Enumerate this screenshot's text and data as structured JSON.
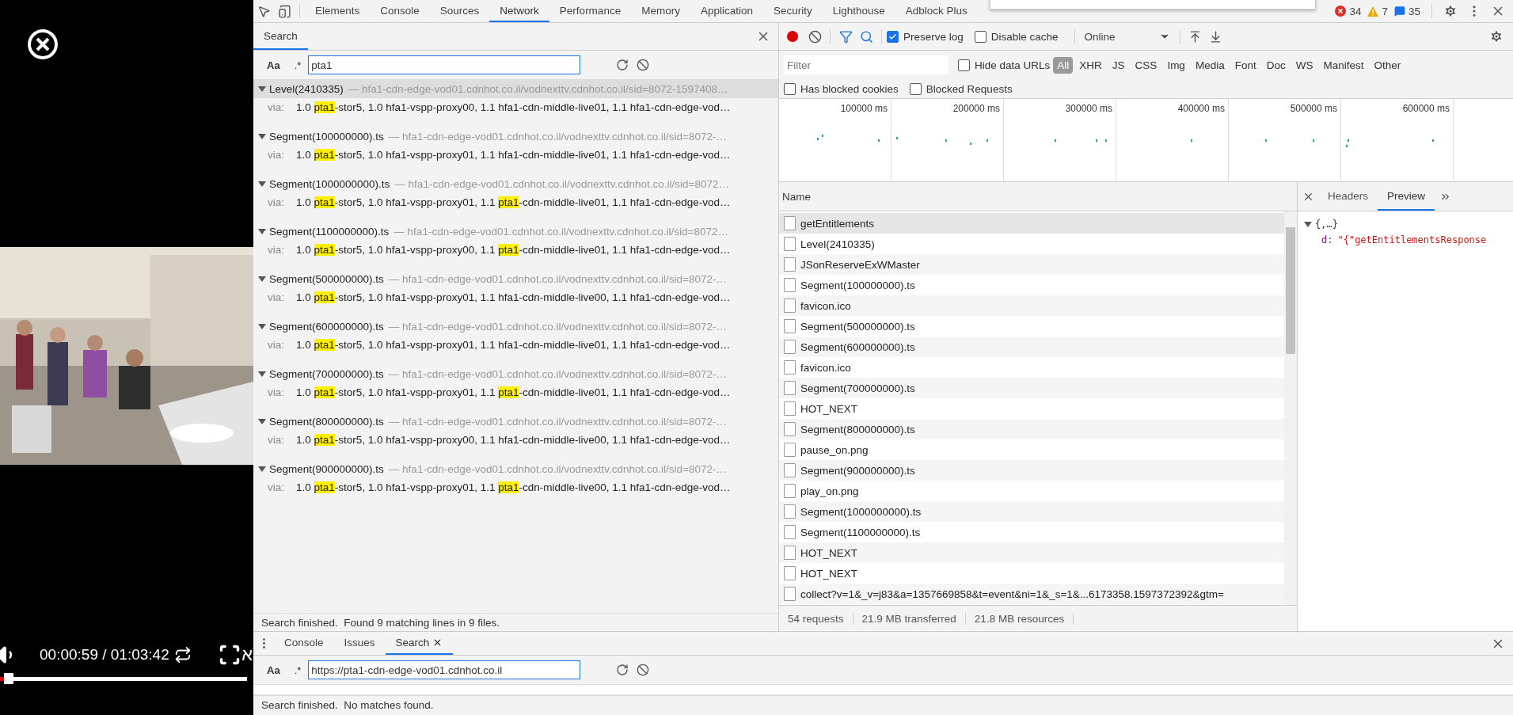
{
  "video": {
    "time": "00:00:59 / 01:03:42",
    "edge_letter": "א",
    "level": 0.03
  },
  "devtools": {
    "tabs": [
      {
        "label": "Elements",
        "selected": false
      },
      {
        "label": "Console",
        "selected": false
      },
      {
        "label": "Sources",
        "selected": false
      },
      {
        "label": "Network",
        "selected": true
      },
      {
        "label": "Performance",
        "selected": false
      },
      {
        "label": "Memory",
        "selected": false
      },
      {
        "label": "Application",
        "selected": false
      },
      {
        "label": "Security",
        "selected": false
      },
      {
        "label": "Lighthouse",
        "selected": false
      },
      {
        "label": "Adblock Plus",
        "selected": false
      }
    ],
    "errors": "34",
    "warnings": "7",
    "messages": "35"
  },
  "search_panel": {
    "title": "Search",
    "case_label": "Aa",
    "regex_label": ".*",
    "query": "pta1",
    "results": [
      {
        "name": "Level(2410335)",
        "url": "— hfa1-cdn-edge-vod01.cdnhot.co.il/vodnexttv.cdnhot.co.il/sid=8072-1597408…",
        "hovered": true,
        "via_label": "via:",
        "segments": [
          {
            "text": "1.0 ",
            "match": false
          },
          {
            "text": "pta1",
            "match": true
          },
          {
            "text": "-stor5, 1.0 hfa1-vspp-proxy00, 1.1 hfa1-cdn-middle-live01, 1.1 hfa1-cdn-edge-vod…",
            "match": false
          }
        ]
      },
      {
        "name": "Segment(100000000).ts",
        "url": "— hfa1-cdn-edge-vod01.cdnhot.co.il/vodnexttv.cdnhot.co.il/sid=8072-…",
        "hovered": false,
        "via_label": "via:",
        "segments": [
          {
            "text": "1.0 ",
            "match": false
          },
          {
            "text": "pta1",
            "match": true
          },
          {
            "text": "-stor5, 1.0 hfa1-vspp-proxy01, 1.1 hfa1-cdn-middle-live01, 1.1 hfa1-cdn-edge-vod…",
            "match": false
          }
        ]
      },
      {
        "name": "Segment(1000000000).ts",
        "url": "— hfa1-cdn-edge-vod01.cdnhot.co.il/vodnexttv.cdnhot.co.il/sid=8072…",
        "hovered": false,
        "via_label": "via:",
        "segments": [
          {
            "text": "1.0 ",
            "match": false
          },
          {
            "text": "pta1",
            "match": true
          },
          {
            "text": "-stor5, 1.0 hfa1-vspp-proxy01, 1.1 ",
            "match": false
          },
          {
            "text": "pta1",
            "match": true
          },
          {
            "text": "-cdn-middle-live01, 1.1 hfa1-cdn-edge-vod…",
            "match": false
          }
        ]
      },
      {
        "name": "Segment(1100000000).ts",
        "url": "— hfa1-cdn-edge-vod01.cdnhot.co.il/vodnexttv.cdnhot.co.il/sid=8072…",
        "hovered": false,
        "via_label": "via:",
        "segments": [
          {
            "text": "1.0 ",
            "match": false
          },
          {
            "text": "pta1",
            "match": true
          },
          {
            "text": "-stor5, 1.0 hfa1-vspp-proxy00, 1.1 ",
            "match": false
          },
          {
            "text": "pta1",
            "match": true
          },
          {
            "text": "-cdn-middle-live01, 1.1 hfa1-cdn-edge-vod…",
            "match": false
          }
        ]
      },
      {
        "name": "Segment(500000000).ts",
        "url": "— hfa1-cdn-edge-vod01.cdnhot.co.il/vodnexttv.cdnhot.co.il/sid=8072-…",
        "hovered": false,
        "via_label": "via:",
        "segments": [
          {
            "text": "1.0 ",
            "match": false
          },
          {
            "text": "pta1",
            "match": true
          },
          {
            "text": "-stor5, 1.0 hfa1-vspp-proxy01, 1.1 hfa1-cdn-middle-live00, 1.1 hfa1-cdn-edge-vod…",
            "match": false
          }
        ]
      },
      {
        "name": "Segment(600000000).ts",
        "url": "— hfa1-cdn-edge-vod01.cdnhot.co.il/vodnexttv.cdnhot.co.il/sid=8072-…",
        "hovered": false,
        "via_label": "via:",
        "segments": [
          {
            "text": "1.0 ",
            "match": false
          },
          {
            "text": "pta1",
            "match": true
          },
          {
            "text": "-stor5, 1.0 hfa1-vspp-proxy01, 1.1 hfa1-cdn-middle-live01, 1.1 hfa1-cdn-edge-vod…",
            "match": false
          }
        ]
      },
      {
        "name": "Segment(700000000).ts",
        "url": "— hfa1-cdn-edge-vod01.cdnhot.co.il/vodnexttv.cdnhot.co.il/sid=8072-…",
        "hovered": false,
        "via_label": "via:",
        "segments": [
          {
            "text": "1.0 ",
            "match": false
          },
          {
            "text": "pta1",
            "match": true
          },
          {
            "text": "-stor5, 1.0 hfa1-vspp-proxy01, 1.1 ",
            "match": false
          },
          {
            "text": "pta1",
            "match": true
          },
          {
            "text": "-cdn-middle-live01, 1.1 hfa1-cdn-edge-vod…",
            "match": false
          }
        ]
      },
      {
        "name": "Segment(800000000).ts",
        "url": "— hfa1-cdn-edge-vod01.cdnhot.co.il/vodnexttv.cdnhot.co.il/sid=8072-…",
        "hovered": false,
        "via_label": "via:",
        "segments": [
          {
            "text": "1.0 ",
            "match": false
          },
          {
            "text": "pta1",
            "match": true
          },
          {
            "text": "-stor5, 1.0 hfa1-vspp-proxy00, 1.1 hfa1-cdn-middle-live00, 1.1 hfa1-cdn-edge-vod…",
            "match": false
          }
        ]
      },
      {
        "name": "Segment(900000000).ts",
        "url": "— hfa1-cdn-edge-vod01.cdnhot.co.il/vodnexttv.cdnhot.co.il/sid=8072-…",
        "hovered": false,
        "via_label": "via:",
        "segments": [
          {
            "text": "1.0 ",
            "match": false
          },
          {
            "text": "pta1",
            "match": true
          },
          {
            "text": "-stor5, 1.0 hfa1-vspp-proxy01, 1.1 ",
            "match": false
          },
          {
            "text": "pta1",
            "match": true
          },
          {
            "text": "-cdn-middle-live00, 1.1 hfa1-cdn-edge-vod…",
            "match": false
          }
        ]
      }
    ],
    "status": "Search finished.  Found 9 matching lines in 9 files."
  },
  "network": {
    "record_on": true,
    "filter_active": true,
    "preserve_log": {
      "label": "Preserve log",
      "checked": true
    },
    "disable_cache": {
      "label": "Disable cache",
      "checked": false
    },
    "throttle": "Online",
    "filter_placeholder": "Filter",
    "hide_data_urls": {
      "label": "Hide data URLs",
      "checked": false
    },
    "types": [
      {
        "label": "All",
        "selected": true
      },
      {
        "label": "XHR",
        "selected": false
      },
      {
        "label": "JS",
        "selected": false
      },
      {
        "label": "CSS",
        "selected": false
      },
      {
        "label": "Img",
        "selected": false
      },
      {
        "label": "Media",
        "selected": false
      },
      {
        "label": "Font",
        "selected": false
      },
      {
        "label": "Doc",
        "selected": false
      },
      {
        "label": "WS",
        "selected": false
      },
      {
        "label": "Manifest",
        "selected": false
      },
      {
        "label": "Other",
        "selected": false
      }
    ],
    "options": [
      {
        "label": "Has blocked cookies",
        "checked": false
      },
      {
        "label": "Blocked Requests",
        "checked": false
      }
    ],
    "timeline_ticks": [
      "100000 ms",
      "200000 ms",
      "300000 ms",
      "400000 ms",
      "500000 ms",
      "600000 ms"
    ],
    "column": "Name",
    "requests": [
      {
        "name": "getEntitlements",
        "selected": true
      },
      {
        "name": "Level(2410335)",
        "selected": false
      },
      {
        "name": "JSonReserveExWMaster",
        "selected": false
      },
      {
        "name": "Segment(100000000).ts",
        "selected": false
      },
      {
        "name": "favicon.ico",
        "selected": false
      },
      {
        "name": "Segment(500000000).ts",
        "selected": false
      },
      {
        "name": "Segment(600000000).ts",
        "selected": false
      },
      {
        "name": "favicon.ico",
        "selected": false
      },
      {
        "name": "Segment(700000000).ts",
        "selected": false
      },
      {
        "name": "HOT_NEXT",
        "selected": false
      },
      {
        "name": "Segment(800000000).ts",
        "selected": false
      },
      {
        "name": "pause_on.png",
        "selected": false
      },
      {
        "name": "Segment(900000000).ts",
        "selected": false
      },
      {
        "name": "play_on.png",
        "selected": false
      },
      {
        "name": "Segment(1000000000).ts",
        "selected": false
      },
      {
        "name": "Segment(1100000000).ts",
        "selected": false
      },
      {
        "name": "HOT_NEXT",
        "selected": false
      },
      {
        "name": "HOT_NEXT",
        "selected": false
      },
      {
        "name": "collect?v=1&_v=j83&a=1357669858&t=event&ni=1&_s=1&...6173358.1597372392&gtm=",
        "selected": false
      }
    ],
    "summary": [
      "54 requests",
      "21.9 MB transferred",
      "21.8 MB resources"
    ],
    "detail_tabs": [
      {
        "label": "Headers",
        "selected": false
      },
      {
        "label": "Preview",
        "selected": true
      }
    ],
    "preview": {
      "expanded": true,
      "summary": "{,…}",
      "key": "d:",
      "value": "\"{\"getEntitlementsResponse"
    }
  },
  "drawer": {
    "tabs": [
      {
        "label": "Console",
        "selected": false,
        "closable": false
      },
      {
        "label": "Issues",
        "selected": false,
        "closable": false
      },
      {
        "label": "Search",
        "selected": true,
        "closable": true
      }
    ],
    "case_label": "Aa",
    "regex_label": ".*",
    "query": "https://pta1-cdn-edge-vod01.cdnhot.co.il",
    "status": "Search finished.  No matches found."
  }
}
